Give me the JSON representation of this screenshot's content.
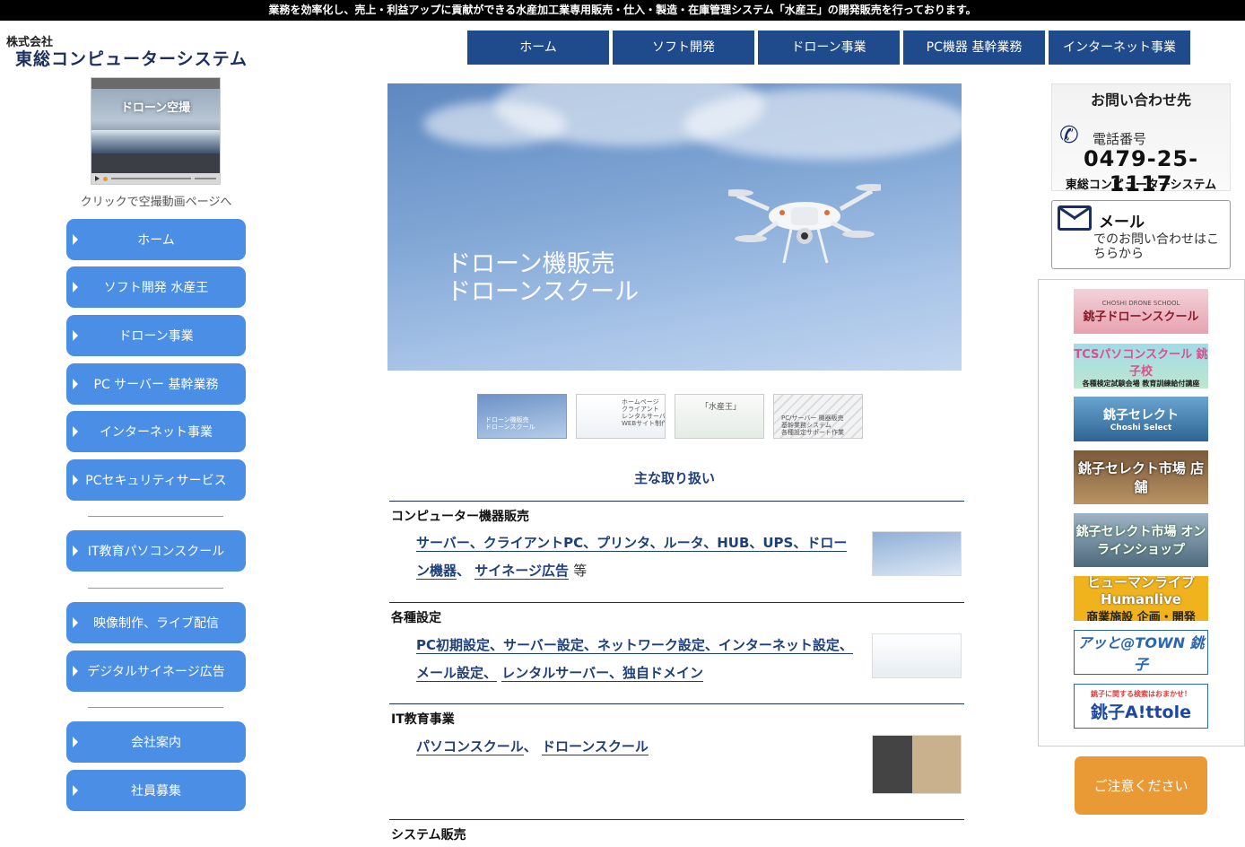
{
  "top_banner": "業務を効率化し、売上・利益アップに貢献ができる水産加工業専用販売・仕入・製造・在庫管理システム「水産王」の開発販売を行っております。",
  "company": {
    "prefix": "株式会社",
    "name": "東総コンピューターシステム"
  },
  "top_nav": [
    "ホーム",
    "ソフト開発",
    "ドローン事業",
    "PC機器 基幹業務",
    "インターネット事業"
  ],
  "video": {
    "overlay_title": "ドローン空撮",
    "caption": "クリックで空撮動画ページへ"
  },
  "left_nav": {
    "group1": [
      "ホーム",
      "ソフト開発 水産王",
      "ドローン事業",
      "PC サーバー 基幹業務",
      "インターネット事業",
      "PCセキュリティサービス"
    ],
    "group2": [
      "IT教育パソコンスクール"
    ],
    "group3": [
      "映像制作、ライブ配信",
      "デジタルサイネージ広告"
    ],
    "group4": [
      "会社案内",
      "社員募集"
    ]
  },
  "hero": {
    "line1": "ドローン機販売",
    "line2": "ドローンスクール"
  },
  "thumbnails": [
    {
      "text": "ドローン機販売\nドローンスクール"
    },
    {
      "text": "ホームページ\nクライアント\nレンタルサーバー\nWEBサイト制作"
    },
    {
      "text": "「水産王」"
    },
    {
      "text": "PC/サーバー 機器販売\n基幹業務システム\n各種設定サポート作業"
    }
  ],
  "main": {
    "section_title": "主な取り扱い",
    "categories": [
      {
        "heading": "コンピューター機器販売",
        "links": [
          "サーバー、クライアントPC、プリンタ、ルータ、HUB、UPS、ドローン機器",
          "サイネージ広告"
        ],
        "suffix": "等"
      },
      {
        "heading": "各種設定",
        "links": [
          "PC初期設定、サーバー設定、ネットワーク設定、インターネット設定、メール設定、",
          "レンタルサーバー、独自ドメイン"
        ]
      },
      {
        "heading": "IT教育事業",
        "links": [
          "パソコンスクール",
          "ドローンスクール"
        ]
      },
      {
        "heading": "システム販売"
      }
    ]
  },
  "contact_phone": {
    "title": "お問い合わせ先",
    "label": "電話番号",
    "number": "0479-25-1117",
    "company": "東総コンピューターシステム"
  },
  "contact_mail": {
    "title": "メール",
    "desc": "でのお問い合わせはこちらから"
  },
  "banners": [
    {
      "sub": "CHOSHI DRONE SCHOOL",
      "main": "銚子ドローンスクール"
    },
    {
      "main": "TCSパソコンスクール 銚子校",
      "sub": "各種検定試験会場 教育訓練給付講座"
    },
    {
      "main": "銚子セレクト",
      "sub": "Choshi Select"
    },
    {
      "main": "銚子セレクト市場 店舗"
    },
    {
      "main": "銚子セレクト市場 オンラインショップ"
    },
    {
      "main": "ヒューマンライブ Humanlive",
      "sub": "商業施設 企画・開発"
    },
    {
      "main": "アッと@TOWN 銚子"
    },
    {
      "sub": "銚子に関する検索はおまかせ！",
      "main": "銚子A!ttole"
    }
  ],
  "caution": "ご注意ください",
  "colors": {
    "nav_blue": "#1f4a8c",
    "button_blue": "#4a8ee6",
    "link_blue": "#1f3f78",
    "orange": "#ea9a34"
  }
}
